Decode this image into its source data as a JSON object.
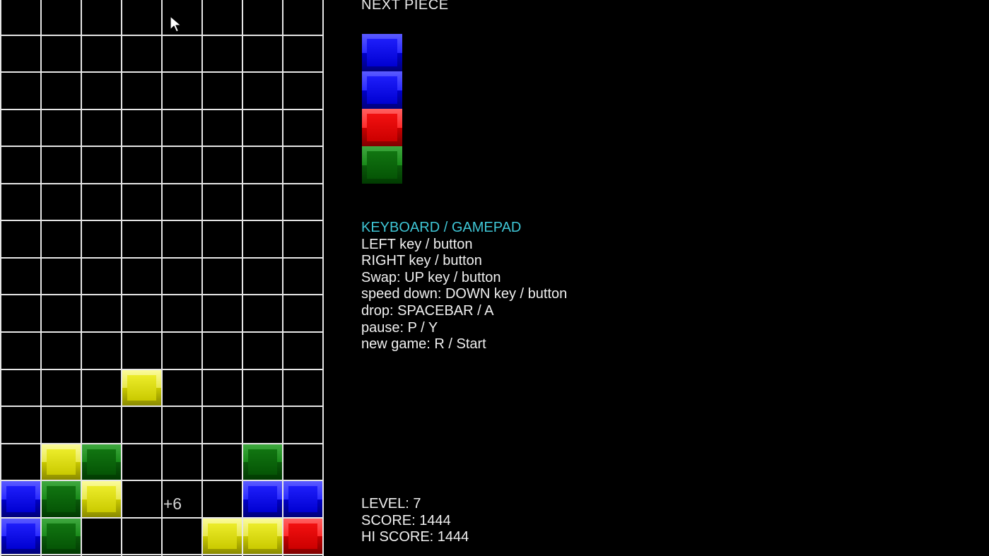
{
  "game": {
    "board_cols": 8,
    "board_rows": 15,
    "colors": {
      "yellow": "#e6e600",
      "blue": "#0a0aff",
      "green": "#0a6a0a",
      "red": "#ee0000",
      "grid": "#e6e6e6",
      "background": "#000000",
      "heading": "#3fc6d6"
    },
    "falling_piece": [
      {
        "row": 10,
        "col": 3,
        "color": "yellow"
      }
    ],
    "settled_blocks": [
      {
        "row": 12,
        "col": 1,
        "color": "yellow"
      },
      {
        "row": 12,
        "col": 2,
        "color": "green"
      },
      {
        "row": 12,
        "col": 6,
        "color": "green"
      },
      {
        "row": 13,
        "col": 0,
        "color": "blue"
      },
      {
        "row": 13,
        "col": 1,
        "color": "green"
      },
      {
        "row": 13,
        "col": 2,
        "color": "yellow"
      },
      {
        "row": 13,
        "col": 6,
        "color": "blue"
      },
      {
        "row": 13,
        "col": 7,
        "color": "blue"
      },
      {
        "row": 14,
        "col": 0,
        "color": "blue"
      },
      {
        "row": 14,
        "col": 1,
        "color": "green"
      },
      {
        "row": 14,
        "col": 5,
        "color": "yellow"
      },
      {
        "row": 14,
        "col": 6,
        "color": "yellow"
      },
      {
        "row": 14,
        "col": 7,
        "color": "red"
      }
    ],
    "combo_popup": "+6"
  },
  "next_piece": {
    "label": "NEXT PIECE",
    "blocks": [
      "blue",
      "blue",
      "red",
      "green"
    ]
  },
  "controls": {
    "heading": "KEYBOARD / GAMEPAD",
    "lines": [
      "LEFT key / button",
      "RIGHT key / button",
      "Swap: UP key / button",
      "speed down: DOWN key / button",
      "drop: SPACEBAR / A",
      "pause: P / Y",
      "new game: R / Start"
    ]
  },
  "stats": {
    "level": "LEVEL: 7",
    "score": "SCORE: 1444",
    "hi_score": "HI SCORE: 1444"
  },
  "cursor_icon": "arrow-cursor-icon"
}
